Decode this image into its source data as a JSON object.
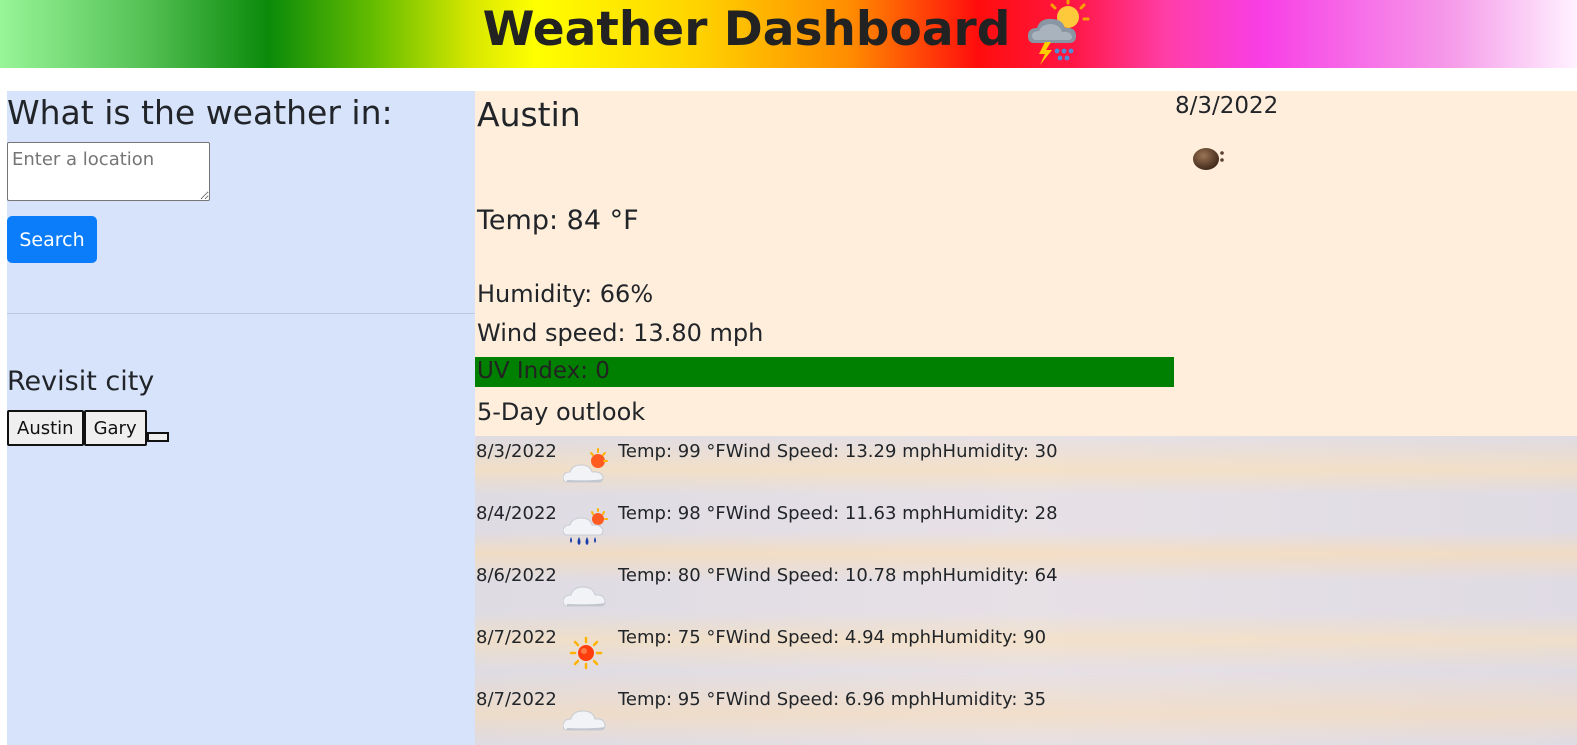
{
  "header": {
    "title": "Weather Dashboard",
    "icon": "cloud-lightning-sun-icon"
  },
  "sidebar": {
    "heading": "What is the weather in:",
    "search": {
      "placeholder": "Enter a location",
      "value": "",
      "button_label": "Search"
    },
    "revisit_heading": "Revisit city",
    "history": [
      "Austin",
      "Gary"
    ]
  },
  "current": {
    "city": "Austin",
    "date": "8/3/2022",
    "icon": "night-moon-icon",
    "temp": "Temp: 84 °F",
    "humidity": "Humidity: 66%",
    "wind": "Wind speed: 13.80 mph",
    "uv": "UV Index: 0",
    "uv_color": "#008000"
  },
  "outlook_heading": "5-Day outlook",
  "forecast": [
    {
      "date": "8/3/2022",
      "icon": "cloud-sun-icon",
      "text": "Temp: 99 °FWind Speed: 13.29 mphHumidity: 30"
    },
    {
      "date": "8/4/2022",
      "icon": "rain-cloud-sun-icon",
      "text": "Temp: 98 °FWind Speed: 11.63 mphHumidity: 28"
    },
    {
      "date": "8/6/2022",
      "icon": "cloud-icon",
      "text": "Temp: 80 °FWind Speed: 10.78 mphHumidity: 64"
    },
    {
      "date": "8/7/2022",
      "icon": "sun-icon",
      "text": "Temp: 75 °FWind Speed: 4.94 mphHumidity: 90"
    },
    {
      "date": "8/7/2022",
      "icon": "cloud-icon",
      "text": "Temp: 95 °FWind Speed: 6.96 mphHumidity: 35"
    }
  ],
  "colors": {
    "sidebar_bg": "#d6e3fb",
    "current_bg": "#ffeedb",
    "search_button": "#0b7dfb"
  }
}
